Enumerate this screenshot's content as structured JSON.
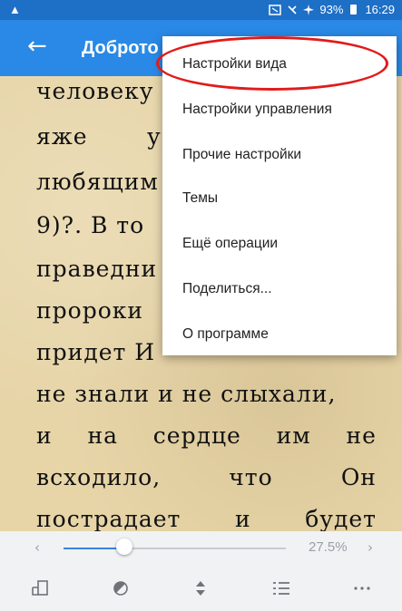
{
  "statusbar": {
    "warning_icon": "warning-icon",
    "battery": "93%",
    "time": "16:29"
  },
  "toolbar": {
    "title": "Доброто"
  },
  "page": {
    "lines": [
      "человеку",
      "яже",
      "любящим",
      "9)?. В то",
      "праведни",
      "пророки",
      "придет И",
      "не знали и не слыхали,",
      [
        "и",
        "на",
        "сердце",
        "им",
        "не"
      ],
      [
        "всходило,",
        "что",
        "Он"
      ],
      [
        "пострадает",
        "и",
        "будет"
      ]
    ],
    "line2_extra": "у"
  },
  "menu": {
    "items": [
      "Настройки вида",
      "Настройки управления",
      "Прочие настройки",
      "Темы",
      "Ещё операции",
      "Поделиться...",
      "О программе"
    ]
  },
  "slider": {
    "progress_percent": 27.5,
    "percent_label": "27.5%"
  },
  "bottombar": {
    "icons": [
      "page-flip-icon",
      "contrast-icon",
      "scroll-arrows-icon",
      "list-icon",
      "more-icon"
    ]
  },
  "colors": {
    "statusbar": "#1e6fc6",
    "toolbar": "#2a89e6",
    "page_bg": "#e7d5a8",
    "highlight": "#e21a1a",
    "accent": "#3b82e0"
  }
}
